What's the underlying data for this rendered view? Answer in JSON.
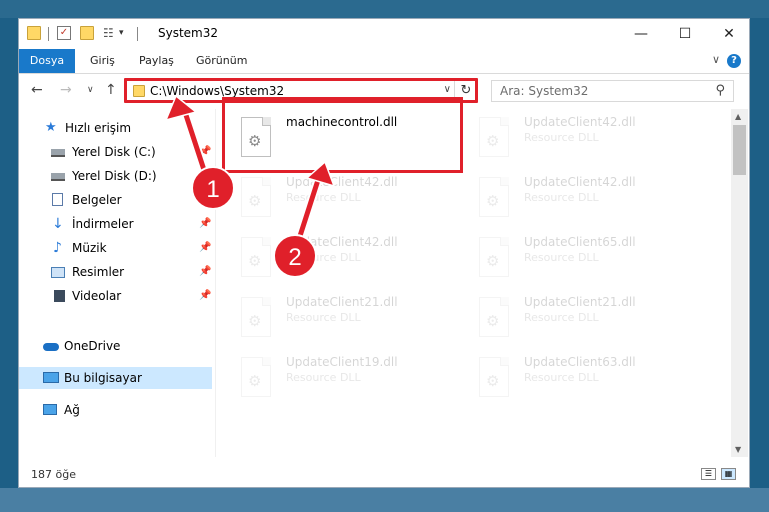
{
  "window": {
    "title": "System32",
    "minimize": "—",
    "maximize": "☐",
    "close": "✕"
  },
  "ribbon": {
    "tabs": [
      {
        "label": "Dosya"
      },
      {
        "label": "Giriş"
      },
      {
        "label": "Paylaş"
      },
      {
        "label": "Görünüm"
      }
    ],
    "help": "?"
  },
  "nav": {
    "back": "←",
    "forward": "→",
    "recent": "∨",
    "up": "↑",
    "address": "C:\\Windows\\System32",
    "refresh": "↻",
    "search_placeholder": "Ara: System32"
  },
  "sidebar": {
    "items": [
      {
        "label": "Hızlı erişim",
        "icon": "star-icon"
      },
      {
        "label": "Yerel Disk (C:)",
        "icon": "drive-icon"
      },
      {
        "label": "Yerel Disk (D:)",
        "icon": "drive-icon"
      },
      {
        "label": "Belgeler",
        "icon": "documents-icon"
      },
      {
        "label": "İndirmeler",
        "icon": "download-icon"
      },
      {
        "label": "Müzik",
        "icon": "music-icon"
      },
      {
        "label": "Resimler",
        "icon": "pictures-icon"
      },
      {
        "label": "Videolar",
        "icon": "videos-icon"
      },
      {
        "label": "OneDrive",
        "icon": "cloud-icon"
      },
      {
        "label": "Bu bilgisayar",
        "icon": "computer-icon"
      },
      {
        "label": "Ağ",
        "icon": "network-icon"
      }
    ]
  },
  "files": [
    {
      "name": "machinecontrol.dll",
      "type": ""
    },
    {
      "name": "UpdateClient42.dll",
      "type": "Resource DLL"
    },
    {
      "name": "UpdateClient42.dll",
      "type": "Resource DLL"
    },
    {
      "name": "UpdateClient42.dll",
      "type": "Resource DLL"
    },
    {
      "name": "UpdateClient42.dll",
      "type": "Resource DLL"
    },
    {
      "name": "UpdateClient65.dll",
      "type": "Resource DLL"
    },
    {
      "name": "UpdateClient21.dll",
      "type": "Resource DLL"
    },
    {
      "name": "UpdateClient21.dll",
      "type": "Resource DLL"
    },
    {
      "name": "UpdateClient19.dll",
      "type": "Resource DLL"
    },
    {
      "name": "UpdateClient63.dll",
      "type": "Resource DLL"
    }
  ],
  "status": {
    "count": "187 öğe"
  },
  "annotations": {
    "step1": "1",
    "step2": "2",
    "color": "#e0202a"
  }
}
